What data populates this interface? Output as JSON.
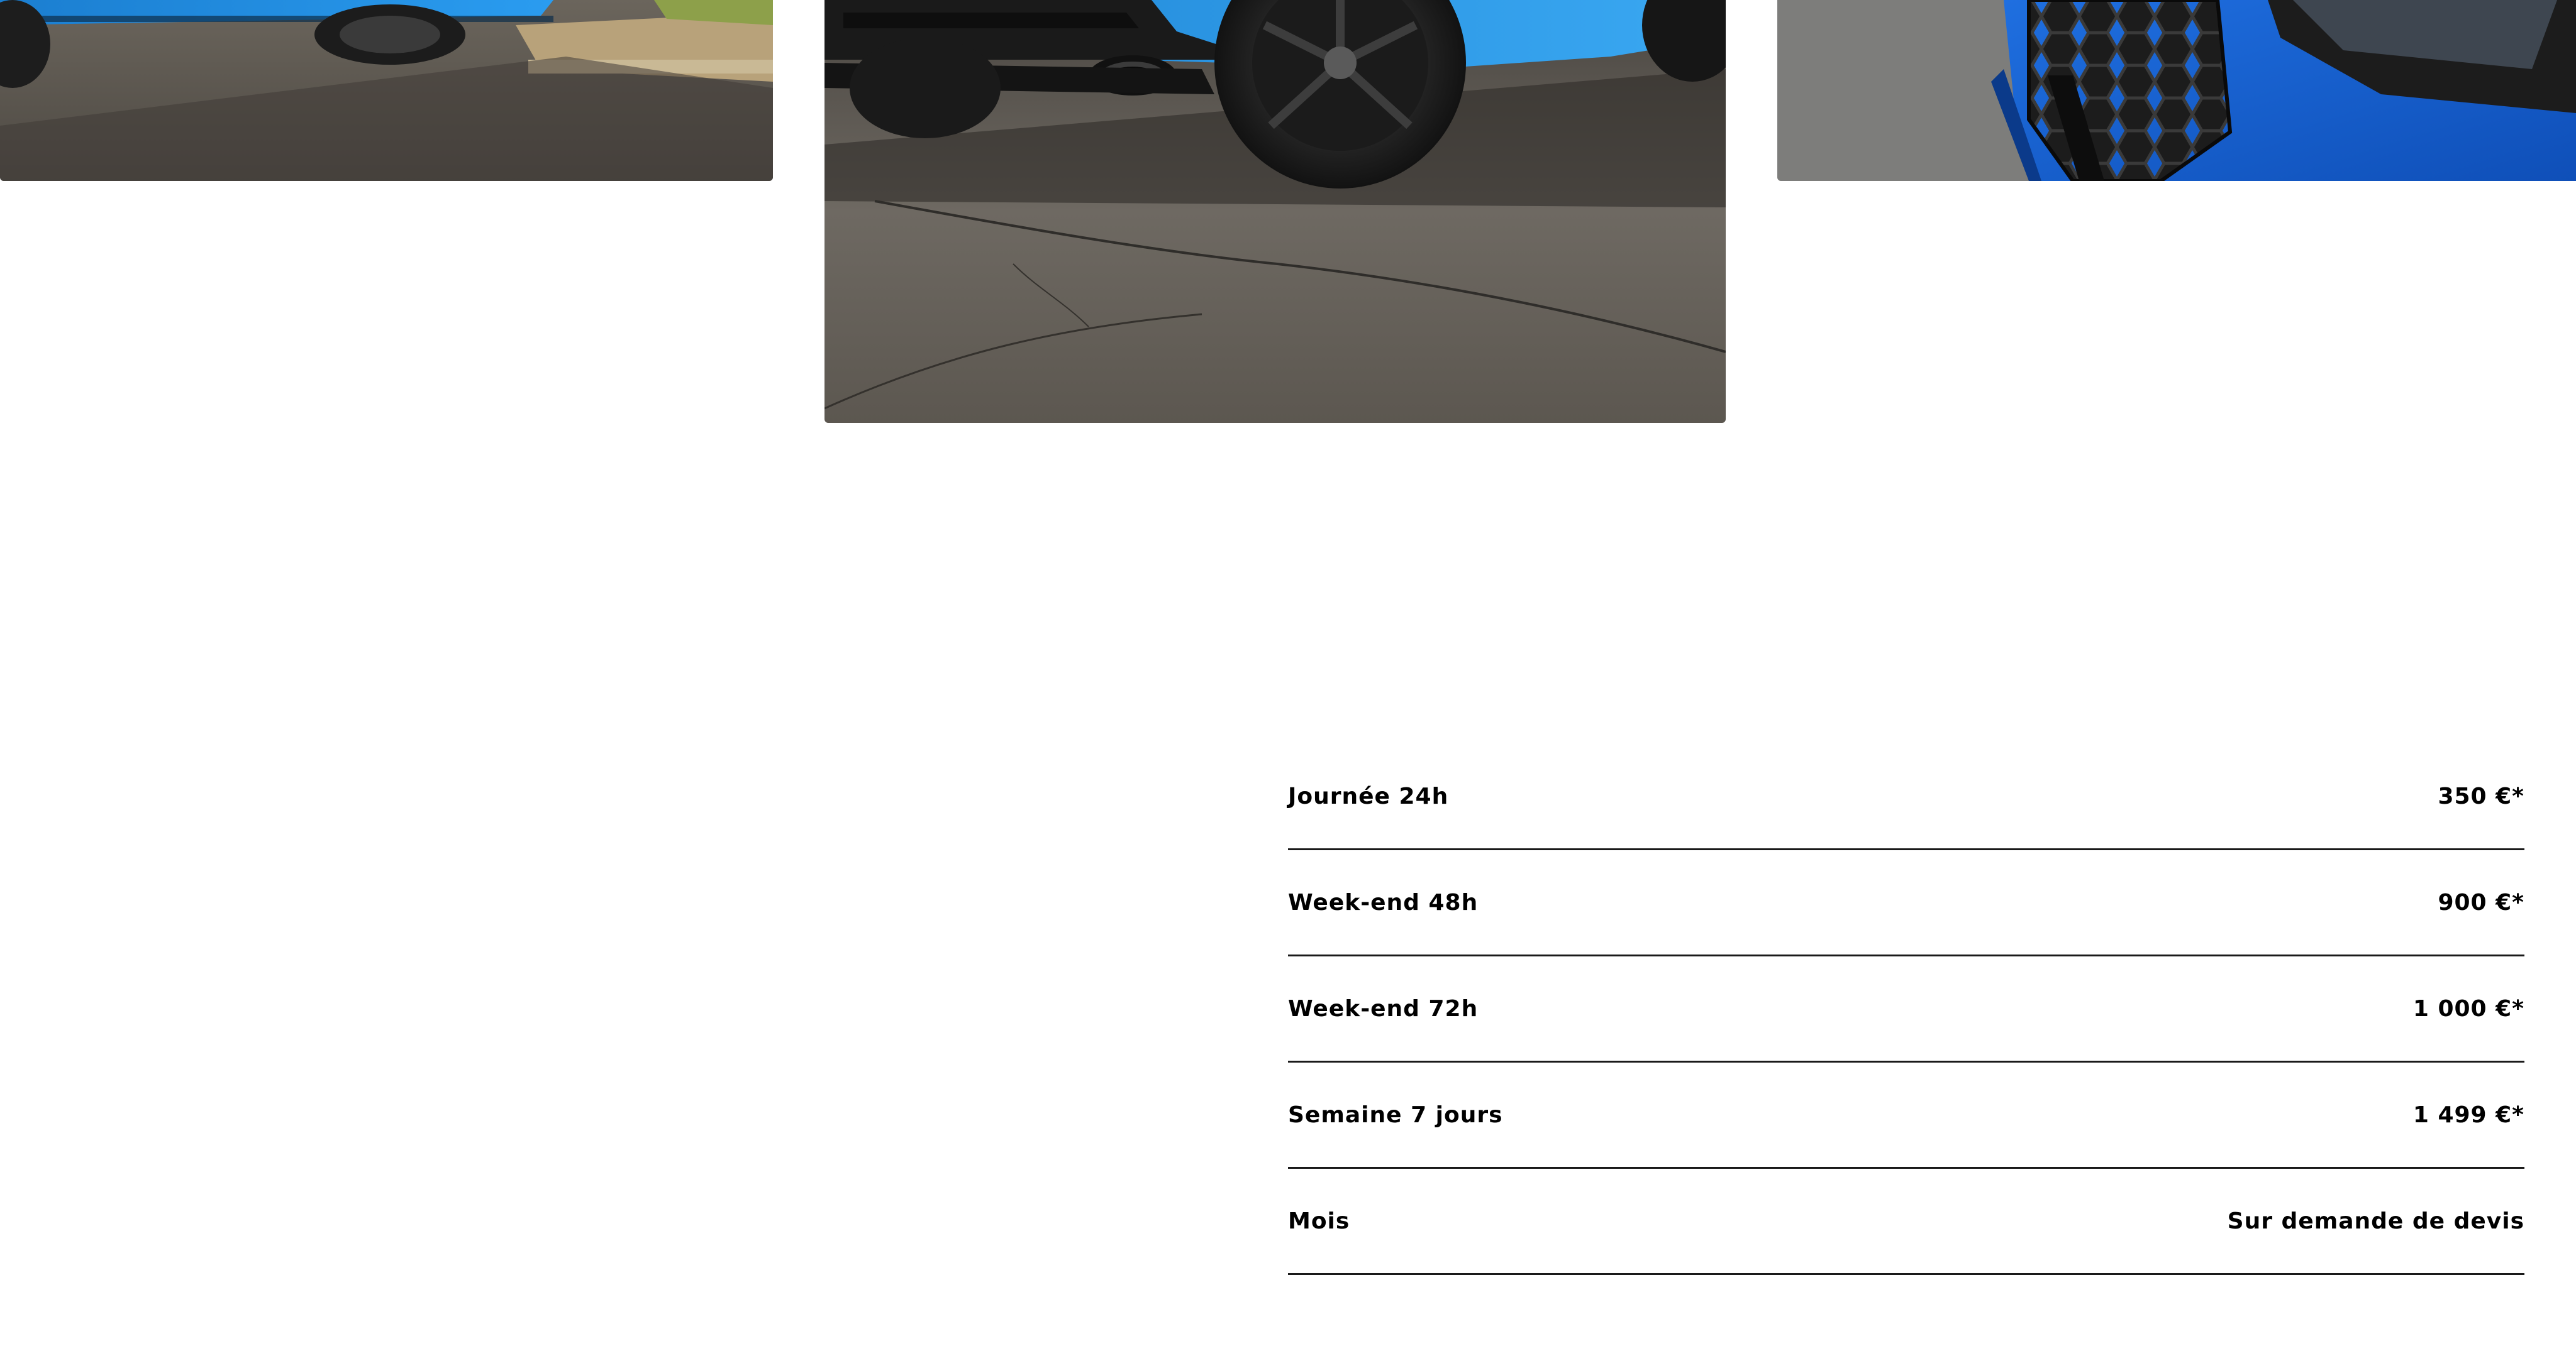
{
  "gallery": {
    "images": [
      {
        "name": "blue-car-front-left-corner",
        "description_icon": "car-photo"
      },
      {
        "name": "blue-car-rear-wheel-exhaust",
        "description_icon": "car-photo"
      },
      {
        "name": "blue-car-front-grille-quattro",
        "description_icon": "car-photo"
      }
    ],
    "colors": {
      "car_blue": "#1e8fe0",
      "car_blue_dark": "#1565c8",
      "asphalt": "#5a5650",
      "asphalt_light": "#7d7870"
    }
  },
  "pricing": {
    "rows": [
      {
        "label": "Journée 24h",
        "value": "350 €*"
      },
      {
        "label": "Week-end 48h",
        "value": "900 €*"
      },
      {
        "label": "Week-end 72h",
        "value": "1 000 €*"
      },
      {
        "label": "Semaine 7 jours",
        "value": "1 499 €*"
      },
      {
        "label": "Mois",
        "value": "Sur demande de devis"
      }
    ],
    "divider_color": "#1a1a1a",
    "text_color": "#000000"
  }
}
